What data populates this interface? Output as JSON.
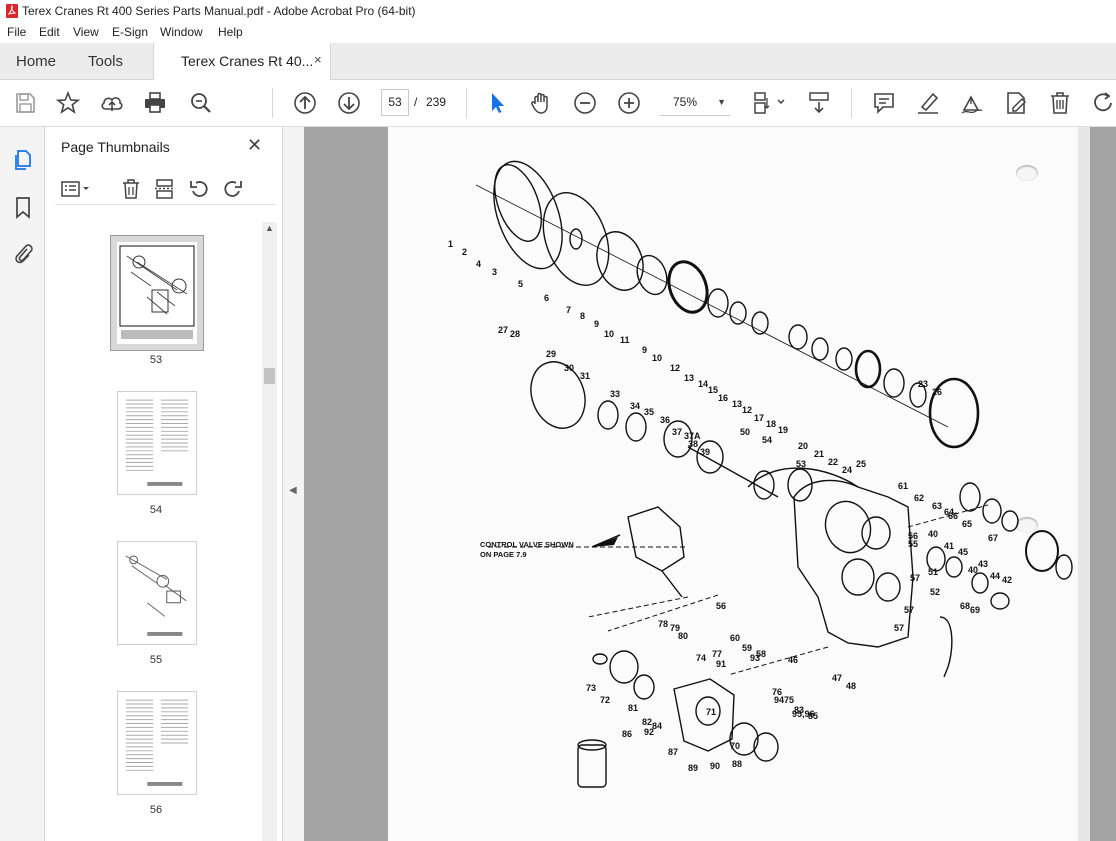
{
  "window": {
    "title": "Terex Cranes Rt 400 Series Parts Manual.pdf - Adobe Acrobat Pro (64-bit)",
    "brand_color": "#d7262c"
  },
  "menu": [
    "File",
    "Edit",
    "View",
    "E-Sign",
    "Window",
    "Help"
  ],
  "tabs": {
    "home": "Home",
    "tools": "Tools",
    "document": "Terex Cranes Rt 40...",
    "close_glyph": "×"
  },
  "toolbar": {
    "current_page": "53",
    "page_separator": "/",
    "total_pages": "239",
    "zoom": "75%",
    "icons": [
      "save-icon",
      "star-icon",
      "upload-icon",
      "print-icon",
      "find-icon",
      "prev-page-icon",
      "next-page-icon",
      "select-arrow-icon",
      "hand-icon",
      "zoom-out-icon",
      "zoom-in-icon",
      "scroll-mode-icon",
      "read-mode-icon",
      "comment-icon",
      "highlight-icon",
      "sign-icon",
      "edit-icon",
      "delete-icon",
      "rotate-icon"
    ],
    "accent_color": "#1473e6"
  },
  "left_rail": {
    "icons": [
      "page-thumbnails-icon",
      "bookmark-icon",
      "attachment-icon"
    ]
  },
  "panel": {
    "title": "Page Thumbnails",
    "close_glyph": "✕",
    "tools": [
      "options-icon",
      "delete-icon",
      "extract-icon",
      "undo-icon",
      "redo-icon"
    ],
    "thumbnails": [
      {
        "page": "53",
        "selected": true
      },
      {
        "page": "54",
        "selected": false
      },
      {
        "page": "55",
        "selected": false
      },
      {
        "page": "56",
        "selected": false
      }
    ]
  },
  "document": {
    "annotation": [
      "CONTROL VALVE SHOWN",
      "ON PAGE 7.9"
    ],
    "callouts": [
      "1",
      "2",
      "3",
      "4",
      "5",
      "6",
      "7",
      "8",
      "9",
      "9",
      "10",
      "10",
      "11",
      "12",
      "12",
      "13",
      "13",
      "14",
      "15",
      "16",
      "17",
      "18",
      "19",
      "20",
      "21",
      "22",
      "23",
      "24",
      "25",
      "26",
      "27",
      "28",
      "29",
      "30",
      "31",
      "33",
      "34",
      "35",
      "36",
      "37",
      "37A",
      "38",
      "39",
      "40",
      "40",
      "41",
      "42",
      "43",
      "44",
      "45",
      "46",
      "47",
      "48",
      "50",
      "51",
      "52",
      "53",
      "54",
      "55",
      "56",
      "56",
      "57",
      "57",
      "57",
      "58",
      "59",
      "60",
      "61",
      "62",
      "63",
      "64",
      "65",
      "66",
      "67",
      "68",
      "69",
      "70",
      "71",
      "72",
      "73",
      "74",
      "75",
      "76",
      "77",
      "78",
      "79",
      "80",
      "81",
      "82",
      "83",
      "84",
      "85",
      "86",
      "87",
      "88",
      "89",
      "90",
      "91",
      "92",
      "93",
      "94",
      "95,96"
    ]
  }
}
